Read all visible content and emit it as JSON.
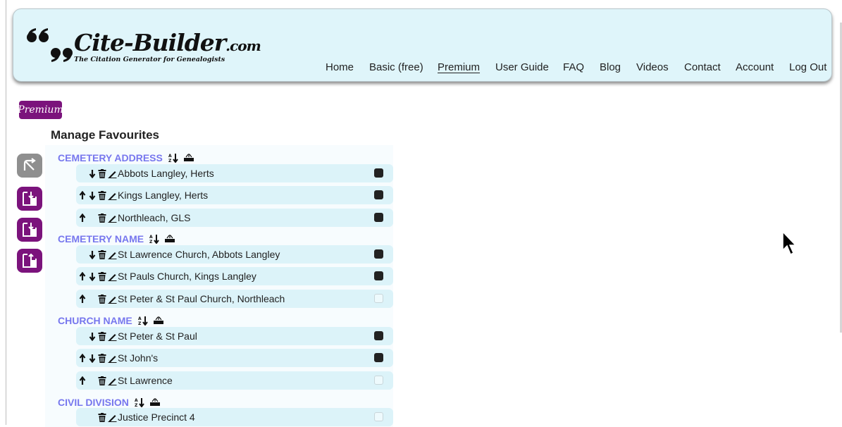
{
  "site": {
    "brand": "Cite-Builder",
    "brand_tld": ".com",
    "tagline": "The Citation Generator for Genealogists"
  },
  "nav": {
    "items": [
      {
        "label": "Home",
        "active": false
      },
      {
        "label": "Basic (free)",
        "active": false
      },
      {
        "label": "Premium",
        "active": true
      },
      {
        "label": "User Guide",
        "active": false
      },
      {
        "label": "FAQ",
        "active": false
      },
      {
        "label": "Blog",
        "active": false
      },
      {
        "label": "Videos",
        "active": false
      },
      {
        "label": "Contact",
        "active": false
      },
      {
        "label": "Account",
        "active": false
      },
      {
        "label": "Log Out",
        "active": false
      }
    ]
  },
  "badge": {
    "label": "Premium"
  },
  "page": {
    "title": "Manage Favourites"
  },
  "tools": [
    {
      "icon": "undo-icon"
    },
    {
      "icon": "import-file-icon"
    },
    {
      "icon": "import-file-icon"
    },
    {
      "icon": "export-file-icon"
    }
  ],
  "groups": [
    {
      "title": "CEMETERY ADDRESS",
      "items": [
        {
          "label": "Abbots Langley, Herts",
          "checked": true
        },
        {
          "label": "Kings Langley, Herts",
          "checked": true
        },
        {
          "label": "Northleach, GLS",
          "checked": true
        }
      ]
    },
    {
      "title": "CEMETERY NAME",
      "items": [
        {
          "label": "St Lawrence Church, Abbots Langley",
          "checked": true
        },
        {
          "label": "St Pauls Church, Kings Langley",
          "checked": true
        },
        {
          "label": "St Peter & St Paul Church, Northleach",
          "checked": false
        }
      ]
    },
    {
      "title": "CHURCH NAME",
      "items": [
        {
          "label": "St Peter & St Paul",
          "checked": true
        },
        {
          "label": "St John's",
          "checked": true
        },
        {
          "label": "St Lawrence",
          "checked": false
        }
      ]
    },
    {
      "title": "CIVIL DIVISION",
      "items": [
        {
          "label": "Justice Precinct 4",
          "checked": false
        }
      ]
    }
  ],
  "colors": {
    "header_bg": "#dff5fa",
    "row_bg": "#dcf3f9",
    "accent_purple": "#7b137c",
    "group_title": "#7777ee"
  }
}
